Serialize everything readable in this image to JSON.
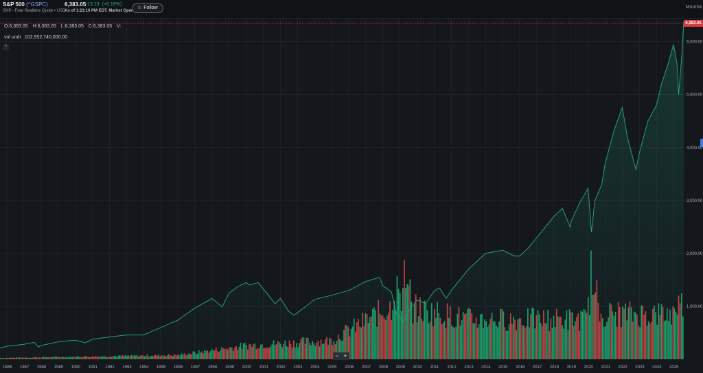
{
  "header": {
    "title": "S&P 500",
    "symbol": "(^GSPC)",
    "subtitle": "SNP - Free Realtime Quote • USD",
    "price": "6,383.05",
    "change": "+13.19",
    "change_pct": "(+0.19%)",
    "as_of": "As of 1:23:10 PM EDT. Market Open.",
    "follow_label": "Follow",
    "right_text": "Mounta"
  },
  "ohlc": {
    "open": "O:6,383.05",
    "high": "H:6,383.05",
    "low": "L:6,383.05",
    "close": "C:6,383.05",
    "volume": "V:"
  },
  "vol_indicator": {
    "name": "vol undr",
    "value": "102,552,740,000.00"
  },
  "last_price_tag": "6,383.05",
  "zoom": {
    "minus": "−",
    "plus": "+"
  },
  "colors": {
    "background": "#14171c",
    "price_line": "#2a9d7f",
    "vol_up": "#1fa971",
    "vol_down": "#d64545",
    "last_price": "#d63a3a"
  },
  "chart_data": {
    "type": "line",
    "title": "",
    "xlabel": "",
    "ylabel": "",
    "x_ticks": [
      "1986",
      "1987",
      "1988",
      "1989",
      "1990",
      "1991",
      "1992",
      "1993",
      "1994",
      "1995",
      "1996",
      "1997",
      "1998",
      "1999",
      "2000",
      "2001",
      "2002",
      "2003",
      "2004",
      "2005",
      "2006",
      "2007",
      "2008",
      "2009",
      "2010",
      "2011",
      "2012",
      "2013",
      "2014",
      "2015",
      "2016",
      "2017",
      "2018",
      "2019",
      "2020",
      "2021",
      "2022",
      "2023",
      "2024",
      "2025"
    ],
    "y_ticks": [
      "1,000.00",
      "2,000.00",
      "3,000.00",
      "4,000.00",
      "5,000.00",
      "6,000.00"
    ],
    "ylim": [
      0,
      6450
    ],
    "grid": true,
    "series": [
      {
        "x": [
          1985.6,
          1986.0,
          1987.0,
          1987.6,
          1987.85,
          1988.0,
          1989.0,
          1990.0,
          1990.6,
          1991.0,
          1992.0,
          1993.0,
          1994.0,
          1995.0,
          1996.0,
          1997.0,
          1998.0,
          1998.6,
          1999.0,
          1999.5,
          2000.0,
          2000.2,
          2000.7,
          2001.0,
          2001.7,
          2002.0,
          2002.5,
          2002.8,
          2003.0,
          2003.5,
          2004.0,
          2005.0,
          2006.0,
          2007.0,
          2007.8,
          2008.0,
          2008.5,
          2008.8,
          2009.0,
          2009.2,
          2009.5,
          2010.0,
          2010.5,
          2011.0,
          2011.3,
          2011.7,
          2012.0,
          2013.0,
          2014.0,
          2015.0,
          2015.7,
          2016.0,
          2016.5,
          2017.0,
          2018.0,
          2018.5,
          2018.95,
          2019.0,
          2019.5,
          2020.0,
          2020.2,
          2020.4,
          2020.8,
          2021.0,
          2021.5,
          2022.0,
          2022.3,
          2022.8,
          2023.0,
          2023.5,
          2024.0,
          2024.3,
          2024.7,
          2025.0,
          2025.2,
          2025.3,
          2025.5,
          2025.6
        ],
        "y": [
          211,
          247,
          283,
          320,
          232,
          260,
          330,
          360,
          310,
          380,
          420,
          460,
          460,
          600,
          740,
          970,
          1150,
          990,
          1250,
          1370,
          1450,
          1400,
          1450,
          1330,
          1050,
          1150,
          900,
          830,
          880,
          1000,
          1130,
          1210,
          1300,
          1470,
          1550,
          1390,
          1270,
          850,
          800,
          700,
          920,
          1120,
          1050,
          1290,
          1350,
          1150,
          1300,
          1700,
          2000,
          2060,
          1950,
          1950,
          2100,
          2300,
          2700,
          2850,
          2500,
          2600,
          2950,
          3230,
          2400,
          3000,
          3300,
          3700,
          4300,
          4760,
          4200,
          3580,
          3900,
          4500,
          4800,
          5200,
          5600,
          5950,
          5600,
          5000,
          5800,
          6383
        ]
      }
    ],
    "volume": {
      "name": "vol undr",
      "note": "volume bars (estimated heights relative to scale), red=down month, green=up month"
    }
  }
}
